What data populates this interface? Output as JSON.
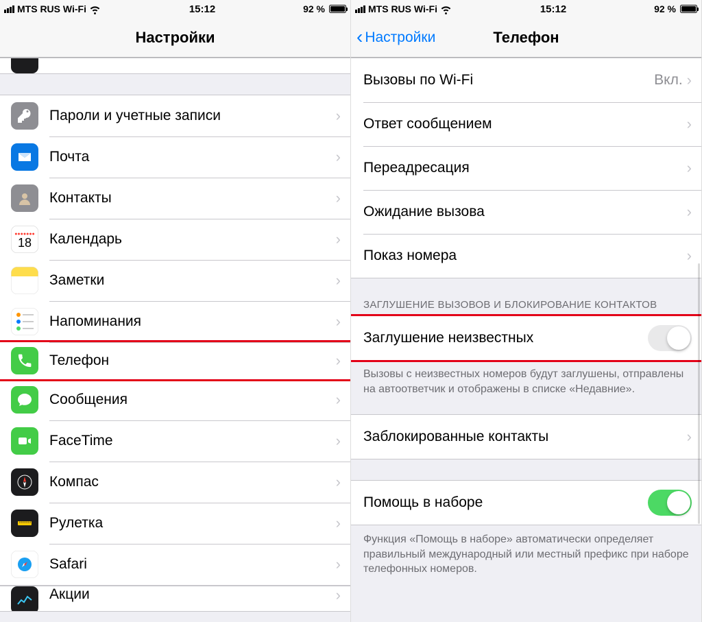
{
  "status": {
    "carrier": "MTS RUS Wi-Fi",
    "time": "15:12",
    "battery": "92 %"
  },
  "left": {
    "title": "Настройки",
    "items": {
      "passwords": "Пароли и учетные записи",
      "mail": "Почта",
      "contacts": "Контакты",
      "calendar": "Календарь",
      "notes": "Заметки",
      "reminders": "Напоминания",
      "phone": "Телефон",
      "messages": "Сообщения",
      "facetime": "FaceTime",
      "compass": "Компас",
      "measure": "Рулетка",
      "safari": "Safari",
      "stocks": "Акции"
    }
  },
  "right": {
    "back": "Настройки",
    "title": "Телефон",
    "wifi_calling": {
      "label": "Вызовы по Wi-Fi",
      "value": "Вкл."
    },
    "respond_text": "Ответ сообщением",
    "forwarding": "Переадресация",
    "call_waiting": "Ожидание вызова",
    "caller_id": "Показ номера",
    "silence_section": "ЗАГЛУШЕНИЕ ВЫЗОВОВ И БЛОКИРОВАНИЕ КОНТАКТОВ",
    "silence_unknown": "Заглушение неизвестных",
    "silence_footer": "Вызовы с неизвестных номеров будут заглушены, отправлены на автоответчик и отображены в списке «Недавние».",
    "blocked": "Заблокированные контакты",
    "dial_assist": "Помощь в наборе",
    "dial_footer": "Функция «Помощь в наборе» автоматически определяет правильный международный или местный префикс при наборе телефонных номеров."
  }
}
